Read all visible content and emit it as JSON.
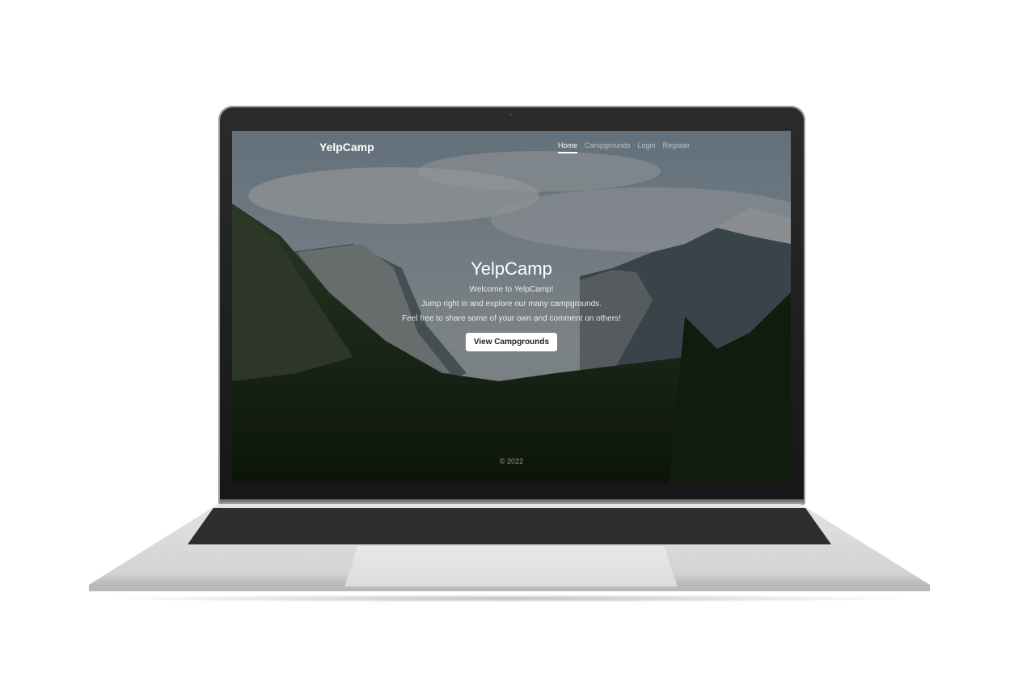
{
  "nav": {
    "brand": "YelpCamp",
    "links": [
      {
        "label": "Home",
        "active": true
      },
      {
        "label": "Campgrounds",
        "active": false
      },
      {
        "label": "Login",
        "active": false
      },
      {
        "label": "Register",
        "active": false
      }
    ]
  },
  "hero": {
    "title": "YelpCamp",
    "lines": [
      "Welcome to YelpCamp!",
      "Jump right in and explore our many campgrounds.",
      "Feel free to share some of your own and comment on others!"
    ],
    "button_label": "View Campgrounds"
  },
  "footer": {
    "text": "© 2022"
  },
  "colors": {
    "overlay": "#000000",
    "text": "#ffffff",
    "button_bg": "#ffffff",
    "device_silver": "#d6d6d6",
    "device_bezel": "#1c1c1c"
  }
}
